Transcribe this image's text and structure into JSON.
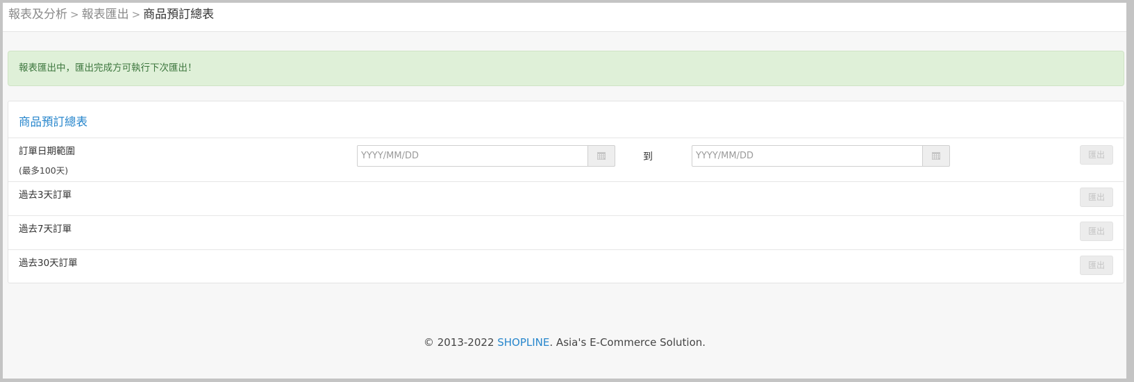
{
  "breadcrumb": {
    "items": [
      "報表及分析",
      "報表匯出",
      "商品預訂總表"
    ],
    "separator": ">"
  },
  "alert": {
    "message": "報表匯出中，匯出完成方可執行下次匯出！"
  },
  "panel": {
    "title": "商品預訂總表",
    "date_range": {
      "label": "訂單日期範圍",
      "note": "(最多100天)",
      "start_placeholder": "YYYY/MM/DD",
      "start_value": "",
      "end_placeholder": "YYYY/MM/DD",
      "end_value": "",
      "to_label": "到",
      "export_label": "匯出",
      "calendar_icon": "calendar-icon"
    },
    "rows": [
      {
        "label": "過去3天訂單",
        "export_label": "匯出"
      },
      {
        "label": "過去7天訂單",
        "export_label": "匯出"
      },
      {
        "label": "過去30天訂單",
        "export_label": "匯出"
      }
    ]
  },
  "footer": {
    "copyright": "© 2013-2022 ",
    "brand": "SHOPLINE",
    "tagline": ". Asia's E-Commerce Solution."
  },
  "colors": {
    "accent": "#2786cc",
    "alert_bg": "#dff0d8",
    "alert_text": "#3c763d"
  }
}
